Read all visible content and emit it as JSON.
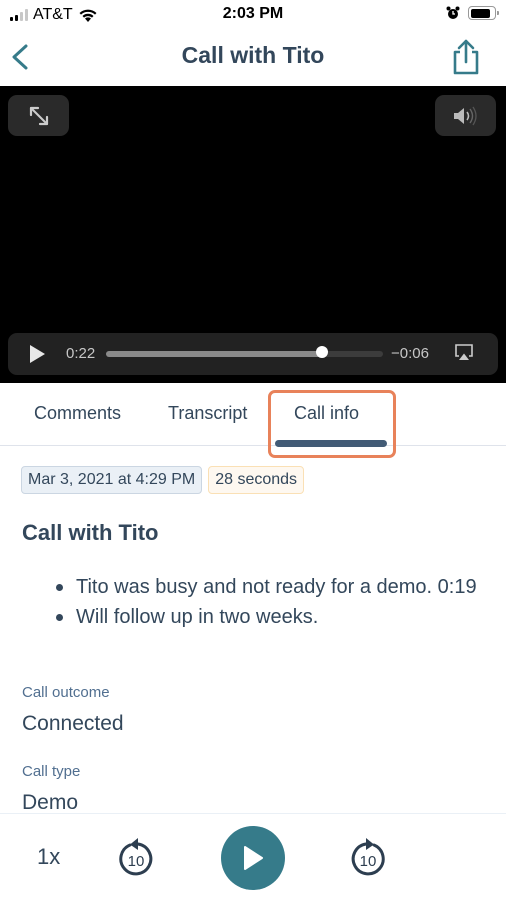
{
  "status_bar": {
    "carrier": "AT&T",
    "time": "2:03 PM",
    "signal_bars_active": 2,
    "signal_bars_total": 4,
    "battery_level": 0.85
  },
  "nav": {
    "title": "Call with Tito",
    "back_icon": "chevron-left-icon",
    "share_icon": "share-icon"
  },
  "video": {
    "current_time": "0:22",
    "remaining_time": "−0:06",
    "progress": 0.78,
    "expand_icon": "expand-icon",
    "volume_icon": "volume-icon",
    "airplay_icon": "airplay-icon"
  },
  "tabs": [
    {
      "label": "Comments",
      "active": false
    },
    {
      "label": "Transcript",
      "active": false
    },
    {
      "label": "Call info",
      "active": true
    }
  ],
  "call_info": {
    "date_badge": "Mar 3, 2021 at 4:29 PM",
    "duration_badge": "28 seconds",
    "title": "Call with Tito",
    "notes": [
      "Tito was busy and not ready for a demo. 0:19",
      "Will follow up in two weeks."
    ],
    "fields": [
      {
        "label": "Call outcome",
        "value": "Connected"
      },
      {
        "label": "Call type",
        "value": "Demo"
      }
    ]
  },
  "player": {
    "speed": "1x",
    "skip_back_seconds": "10",
    "skip_forward_seconds": "10"
  },
  "colors": {
    "accent": "#367b8a",
    "text": "#33475b",
    "highlight": "#e8825a"
  }
}
